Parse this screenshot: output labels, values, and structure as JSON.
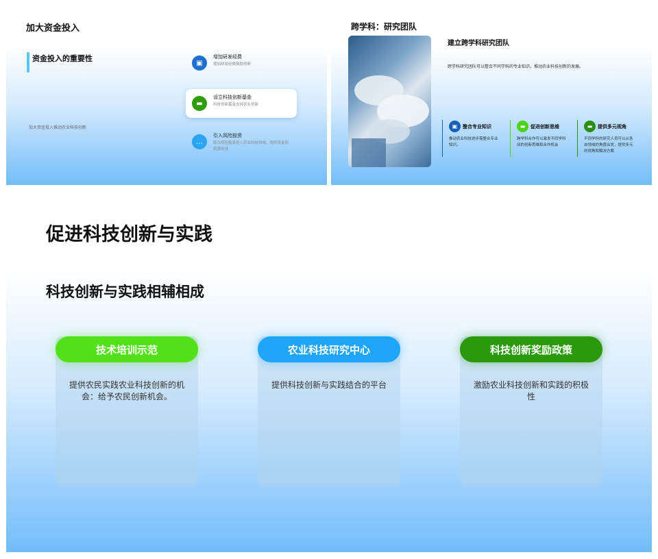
{
  "slide1": {
    "title": "加大资金投入",
    "subtitle": "资金投入的重要性",
    "note": "加大资金投入推动农业科技创新",
    "items": [
      {
        "title": "增加研发经费",
        "desc": "增加研发经费鼓励创新",
        "icon": "image-icon",
        "color": "#1f6fd1",
        "active": false
      },
      {
        "title": "设立科技创新基金",
        "desc": "科技创新基金支持农业创新",
        "icon": "sofa-icon",
        "color": "#2e9e0f",
        "active": true
      },
      {
        "title": "引入风险投资",
        "desc": "吸引风险投资进入农业科技领域，提供资金和资源支持",
        "icon": "chat-icon",
        "color": "#2ba4f3",
        "active": false
      }
    ]
  },
  "slide2": {
    "title": "跨学科：研究团队",
    "heading": "建立跨学科研究团队",
    "description": "跨学科研究团队可以整合不同学科的专业知识，推动农业科技创新的发展。",
    "columns": [
      {
        "title": "整合专业知识",
        "desc": "推动农业科技进步需整合专业知识。",
        "icon": "image-icon",
        "color": "#1760b8"
      },
      {
        "title": "促进创新思维",
        "desc": "跨学科合作可以激发不同学科间的创新思维和合作机会",
        "icon": "sofa-icon",
        "color": "#4cd31a"
      },
      {
        "title": "提供多元视角",
        "desc": "不同学科的研究人员可以从各自领域的角度出发，提供多元的视角和解决方案",
        "icon": "sofa-icon",
        "color": "#2a8f0f"
      }
    ]
  },
  "slide3": {
    "title": "促进科技创新与实践",
    "subtitle": "科技创新与实践相辅相成",
    "cards": [
      {
        "label": "技术培训示范",
        "text": "提供农民实践农业科技创新的机会：给予农民创新机会。",
        "color": "#52e019"
      },
      {
        "label": "农业科技研究中心",
        "text": "提供科技创新与实践结合的平台",
        "color": "#1ea5f7"
      },
      {
        "label": "科技创新奖励政策",
        "text": "激励农业科技创新和实践的积极性",
        "color": "#2a9a0c"
      }
    ]
  }
}
